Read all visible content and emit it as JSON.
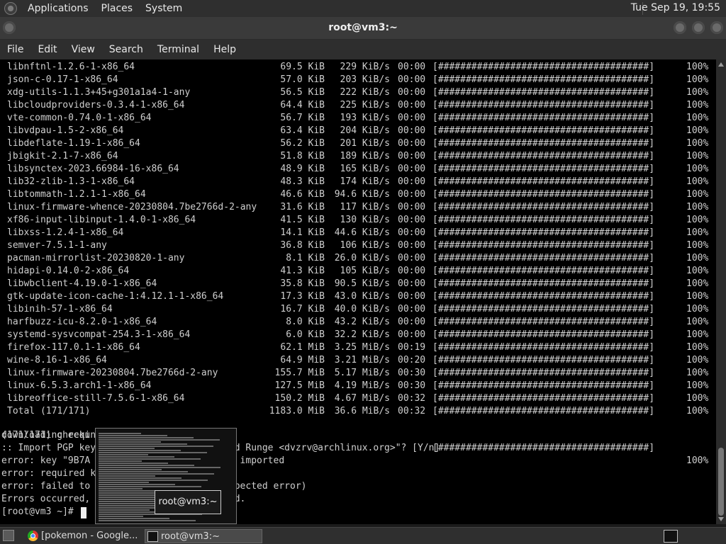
{
  "topbar": {
    "menus": [
      "Applications",
      "Places",
      "System"
    ],
    "clock": "Tue Sep 19, 19:55"
  },
  "window": {
    "title": "root@vm3:~"
  },
  "menubar": [
    "File",
    "Edit",
    "View",
    "Search",
    "Terminal",
    "Help"
  ],
  "terminal": {
    "packages": [
      {
        "name": "libnftnl-1.2.6-1-x86_64",
        "size": "69.5 KiB",
        "speed": "229 KiB/s",
        "time": "00:00",
        "bar": "[######################################]",
        "pct": "100%"
      },
      {
        "name": "json-c-0.17-1-x86_64",
        "size": "57.0 KiB",
        "speed": "203 KiB/s",
        "time": "00:00",
        "bar": "[######################################]",
        "pct": "100%"
      },
      {
        "name": "xdg-utils-1.1.3+45+g301a1a4-1-any",
        "size": "56.5 KiB",
        "speed": "222 KiB/s",
        "time": "00:00",
        "bar": "[######################################]",
        "pct": "100%"
      },
      {
        "name": "libcloudproviders-0.3.4-1-x86_64",
        "size": "64.4 KiB",
        "speed": "225 KiB/s",
        "time": "00:00",
        "bar": "[######################################]",
        "pct": "100%"
      },
      {
        "name": "vte-common-0.74.0-1-x86_64",
        "size": "56.7 KiB",
        "speed": "193 KiB/s",
        "time": "00:00",
        "bar": "[######################################]",
        "pct": "100%"
      },
      {
        "name": "libvdpau-1.5-2-x86_64",
        "size": "63.4 KiB",
        "speed": "204 KiB/s",
        "time": "00:00",
        "bar": "[######################################]",
        "pct": "100%"
      },
      {
        "name": "libdeflate-1.19-1-x86_64",
        "size": "56.2 KiB",
        "speed": "201 KiB/s",
        "time": "00:00",
        "bar": "[######################################]",
        "pct": "100%"
      },
      {
        "name": "jbigkit-2.1-7-x86_64",
        "size": "51.8 KiB",
        "speed": "189 KiB/s",
        "time": "00:00",
        "bar": "[######################################]",
        "pct": "100%"
      },
      {
        "name": "libsynctex-2023.66984-16-x86_64",
        "size": "48.9 KiB",
        "speed": "165 KiB/s",
        "time": "00:00",
        "bar": "[######################################]",
        "pct": "100%"
      },
      {
        "name": "lib32-zlib-1.3-1-x86_64",
        "size": "48.3 KiB",
        "speed": "174 KiB/s",
        "time": "00:00",
        "bar": "[######################################]",
        "pct": "100%"
      },
      {
        "name": "libtommath-1.2.1-1-x86_64",
        "size": "46.6 KiB",
        "speed": "94.6 KiB/s",
        "time": "00:00",
        "bar": "[######################################]",
        "pct": "100%"
      },
      {
        "name": "linux-firmware-whence-20230804.7be2766d-2-any",
        "size": "31.6 KiB",
        "speed": "117 KiB/s",
        "time": "00:00",
        "bar": "[######################################]",
        "pct": "100%"
      },
      {
        "name": "xf86-input-libinput-1.4.0-1-x86_64",
        "size": "41.5 KiB",
        "speed": "130 KiB/s",
        "time": "00:00",
        "bar": "[######################################]",
        "pct": "100%"
      },
      {
        "name": "libxss-1.2.4-1-x86_64",
        "size": "14.1 KiB",
        "speed": "44.6 KiB/s",
        "time": "00:00",
        "bar": "[######################################]",
        "pct": "100%"
      },
      {
        "name": "semver-7.5.1-1-any",
        "size": "36.8 KiB",
        "speed": "106 KiB/s",
        "time": "00:00",
        "bar": "[######################################]",
        "pct": "100%"
      },
      {
        "name": "pacman-mirrorlist-20230820-1-any",
        "size": "8.1 KiB",
        "speed": "26.0 KiB/s",
        "time": "00:00",
        "bar": "[######################################]",
        "pct": "100%"
      },
      {
        "name": "hidapi-0.14.0-2-x86_64",
        "size": "41.3 KiB",
        "speed": "105 KiB/s",
        "time": "00:00",
        "bar": "[######################################]",
        "pct": "100%"
      },
      {
        "name": "libwbclient-4.19.0-1-x86_64",
        "size": "35.8 KiB",
        "speed": "90.5 KiB/s",
        "time": "00:00",
        "bar": "[######################################]",
        "pct": "100%"
      },
      {
        "name": "gtk-update-icon-cache-1:4.12.1-1-x86_64",
        "size": "17.3 KiB",
        "speed": "43.0 KiB/s",
        "time": "00:00",
        "bar": "[######################################]",
        "pct": "100%"
      },
      {
        "name": "libinih-57-1-x86_64",
        "size": "16.7 KiB",
        "speed": "40.0 KiB/s",
        "time": "00:00",
        "bar": "[######################################]",
        "pct": "100%"
      },
      {
        "name": "harfbuzz-icu-8.2.0-1-x86_64",
        "size": "8.0 KiB",
        "speed": "43.2 KiB/s",
        "time": "00:00",
        "bar": "[######################################]",
        "pct": "100%"
      },
      {
        "name": "systemd-sysvcompat-254.3-1-x86_64",
        "size": "6.0 KiB",
        "speed": "32.2 KiB/s",
        "time": "00:00",
        "bar": "[######################################]",
        "pct": "100%"
      },
      {
        "name": "firefox-117.0.1-1-x86_64",
        "size": "62.1 MiB",
        "speed": "3.25 MiB/s",
        "time": "00:19",
        "bar": "[######################################]",
        "pct": "100%"
      },
      {
        "name": "wine-8.16-1-x86_64",
        "size": "64.9 MiB",
        "speed": "3.21 MiB/s",
        "time": "00:20",
        "bar": "[######################################]",
        "pct": "100%"
      },
      {
        "name": "linux-firmware-20230804.7be2766d-2-any",
        "size": "155.7 MiB",
        "speed": "5.17 MiB/s",
        "time": "00:30",
        "bar": "[######################################]",
        "pct": "100%"
      },
      {
        "name": "linux-6.5.3.arch1-1-x86_64",
        "size": "127.5 MiB",
        "speed": "4.19 MiB/s",
        "time": "00:30",
        "bar": "[######################################]",
        "pct": "100%"
      },
      {
        "name": "libreoffice-still-7.5.6-1-x86_64",
        "size": "150.2 MiB",
        "speed": "4.67 MiB/s",
        "time": "00:32",
        "bar": "[######################################]",
        "pct": "100%"
      },
      {
        "name": "Total (171/171)",
        "size": "1183.0 MiB",
        "speed": "36.6 MiB/s",
        "time": "00:32",
        "bar": "[######################################]",
        "pct": "100%"
      }
    ],
    "keyring_line": "(171/171) checking keys in keyring",
    "keyring_bar": "[######################################]",
    "keyring_pct": "100%",
    "lines": [
      "downloading requ",
      ":: Import PGP key                         d Runge <dvzrv@archlinux.org>\"? [Y/n]",
      "error: key \"9B7A                         e imported",
      "error: required k",
      "error: failed to                          pected error)",
      "Errors occurred,                          d.",
      "[root@vm3 ~]# "
    ]
  },
  "preview_tooltip": "root@vm3:~",
  "taskbar": {
    "tasks": [
      {
        "label": "[pokemon - Google...",
        "icon": "chrome-icon"
      },
      {
        "label": "root@vm3:~",
        "icon": "terminal-icon"
      }
    ]
  }
}
